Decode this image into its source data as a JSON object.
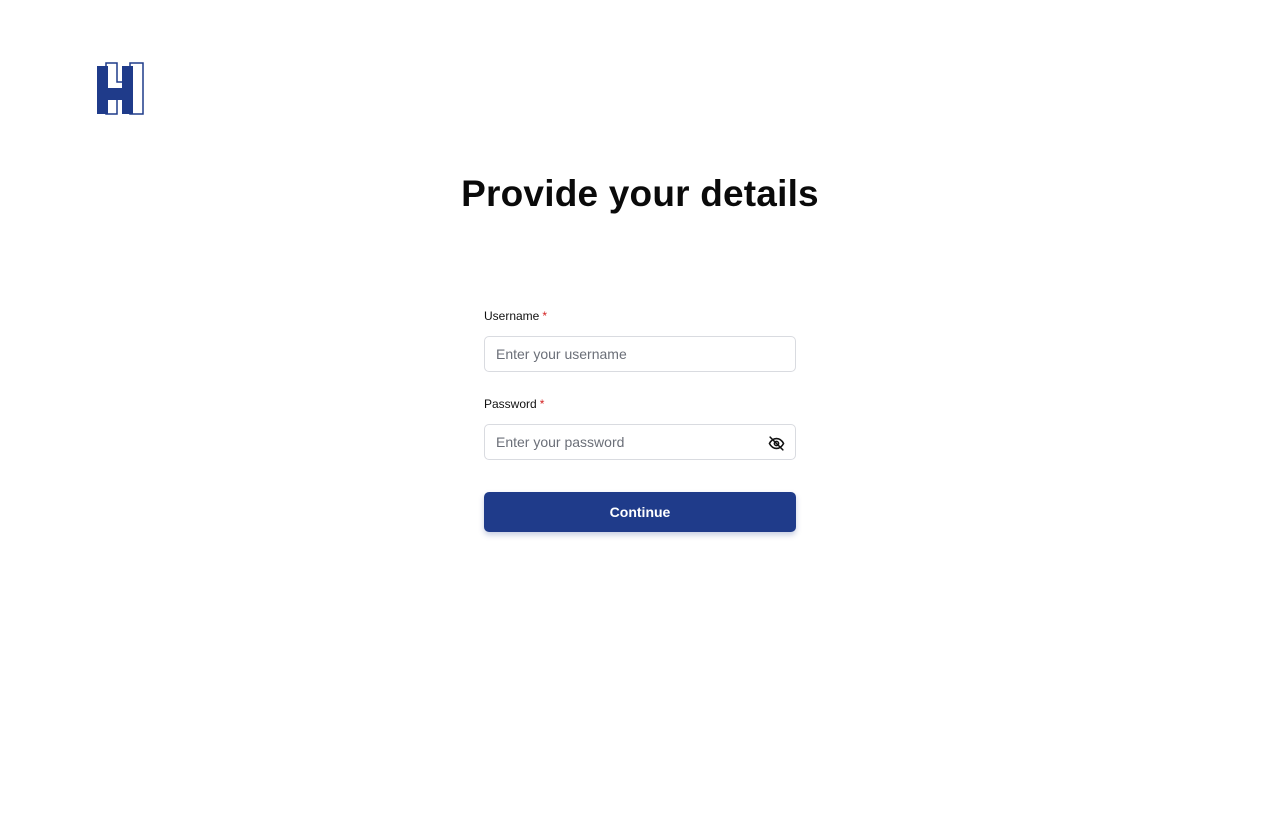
{
  "brand": {
    "logo_icon": "hotel-h-logo",
    "accent_color": "#1f3b8a"
  },
  "page": {
    "title": "Provide your details"
  },
  "form": {
    "username": {
      "label": "Username",
      "required_marker": "*",
      "placeholder": "Enter your username",
      "value": ""
    },
    "password": {
      "label": "Password",
      "required_marker": "*",
      "placeholder": "Enter your password",
      "value": "",
      "visibility_icon": "eye-off-icon"
    },
    "submit_label": "Continue"
  }
}
